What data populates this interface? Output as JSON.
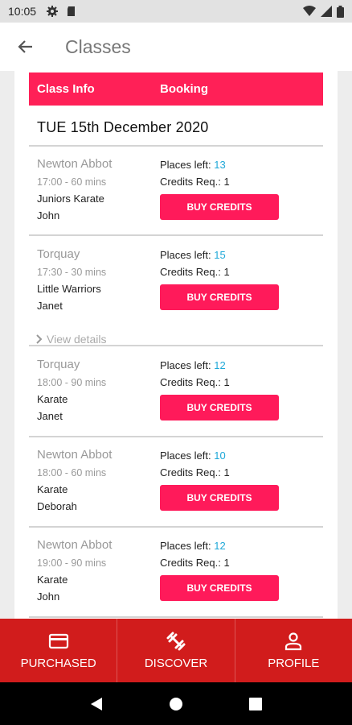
{
  "status_bar": {
    "time": "10:05"
  },
  "app_bar": {
    "title": "Classes"
  },
  "table_header": {
    "col_info": "Class Info",
    "col_booking": "Booking"
  },
  "date_heading": "TUE 15th December 2020",
  "classes": [
    {
      "location": "Newton Abbot",
      "timing": "17:00 - 60 mins",
      "name": "Juniors Karate",
      "instructor": "John",
      "places_label": "Places left:",
      "places": "13",
      "credits": "Credits Req.: 1",
      "button": "BUY CREDITS",
      "details": ""
    },
    {
      "location": "Torquay",
      "timing": "17:30 - 30 mins",
      "name": "Little Warriors",
      "instructor": "Janet",
      "places_label": "Places left:",
      "places": "15",
      "credits": "Credits Req.: 1",
      "button": "BUY CREDITS",
      "details": "View details"
    },
    {
      "location": "Torquay",
      "timing": "18:00 - 90 mins",
      "name": "Karate",
      "instructor": "Janet",
      "places_label": "Places left:",
      "places": "12",
      "credits": "Credits Req.: 1",
      "button": "BUY CREDITS",
      "details": ""
    },
    {
      "location": "Newton Abbot",
      "timing": "18:00 - 60 mins",
      "name": "Karate",
      "instructor": "Deborah",
      "places_label": "Places left:",
      "places": "10",
      "credits": "Credits Req.: 1",
      "button": "BUY CREDITS",
      "details": ""
    },
    {
      "location": "Newton Abbot",
      "timing": "19:00 - 90 mins",
      "name": "Karate",
      "instructor": "John",
      "places_label": "Places left:",
      "places": "12",
      "credits": "Credits Req.: 1",
      "button": "BUY CREDITS",
      "details": ""
    }
  ],
  "bottom_nav": [
    {
      "label": "PURCHASED",
      "icon": "card-icon"
    },
    {
      "label": "DISCOVER",
      "icon": "fitness-icon"
    },
    {
      "label": "PROFILE",
      "icon": "person-icon"
    }
  ],
  "colors": {
    "accent": "#ff2057",
    "nav_bg": "#d11c1c",
    "places_number": "#20a8d8"
  }
}
